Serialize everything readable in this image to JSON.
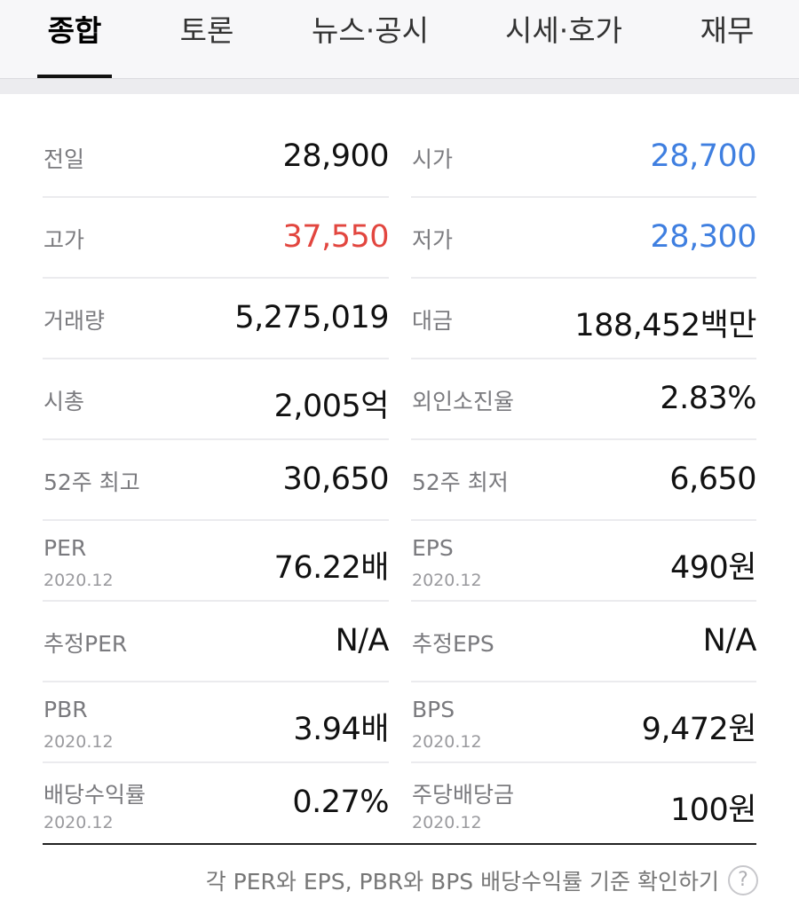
{
  "tabs": [
    {
      "label": "종합",
      "active": true
    },
    {
      "label": "토론",
      "active": false
    },
    {
      "label": "뉴스·공시",
      "active": false
    },
    {
      "label": "시세·호가",
      "active": false
    },
    {
      "label": "재무",
      "active": false
    }
  ],
  "rows": [
    {
      "left": {
        "label": "전일",
        "sub": "",
        "value": "28,900",
        "color": "#111111"
      },
      "right": {
        "label": "시가",
        "sub": "",
        "value": "28,700",
        "color": "#3f7fe0"
      }
    },
    {
      "left": {
        "label": "고가",
        "sub": "",
        "value": "37,550",
        "color": "#e2463f"
      },
      "right": {
        "label": "저가",
        "sub": "",
        "value": "28,300",
        "color": "#3f7fe0"
      }
    },
    {
      "left": {
        "label": "거래량",
        "sub": "",
        "value": "5,275,019",
        "color": "#111111"
      },
      "right": {
        "label": "대금",
        "sub": "",
        "value": "188,452백만",
        "color": "#111111"
      }
    },
    {
      "left": {
        "label": "시총",
        "sub": "",
        "value": "2,005억",
        "color": "#111111"
      },
      "right": {
        "label": "외인소진율",
        "sub": "",
        "value": "2.83%",
        "color": "#111111"
      }
    },
    {
      "left": {
        "label": "52주 최고",
        "sub": "",
        "value": "30,650",
        "color": "#111111"
      },
      "right": {
        "label": "52주 최저",
        "sub": "",
        "value": "6,650",
        "color": "#111111"
      }
    },
    {
      "left": {
        "label": "PER",
        "sub": "2020.12",
        "value": "76.22배",
        "color": "#111111"
      },
      "right": {
        "label": "EPS",
        "sub": "2020.12",
        "value": "490원",
        "color": "#111111"
      }
    },
    {
      "left": {
        "label": "추정PER",
        "sub": "",
        "value": "N/A",
        "color": "#111111"
      },
      "right": {
        "label": "추정EPS",
        "sub": "",
        "value": "N/A",
        "color": "#111111"
      }
    },
    {
      "left": {
        "label": "PBR",
        "sub": "2020.12",
        "value": "3.94배",
        "color": "#111111"
      },
      "right": {
        "label": "BPS",
        "sub": "2020.12",
        "value": "9,472원",
        "color": "#111111"
      }
    },
    {
      "left": {
        "label": "배당수익률",
        "sub": "2020.12",
        "value": "0.27%",
        "color": "#111111"
      },
      "right": {
        "label": "주당배당금",
        "sub": "2020.12",
        "value": "100원",
        "color": "#111111"
      }
    }
  ],
  "footer": {
    "text": "각 PER와 EPS, PBR와 BPS 배당수익률 기준 확인하기",
    "help_icon": "question-circle-icon",
    "help_glyph": "?"
  },
  "colors": {
    "up_red": "#e2463f",
    "down_blue": "#3f7fe0",
    "neutral": "#111111"
  }
}
